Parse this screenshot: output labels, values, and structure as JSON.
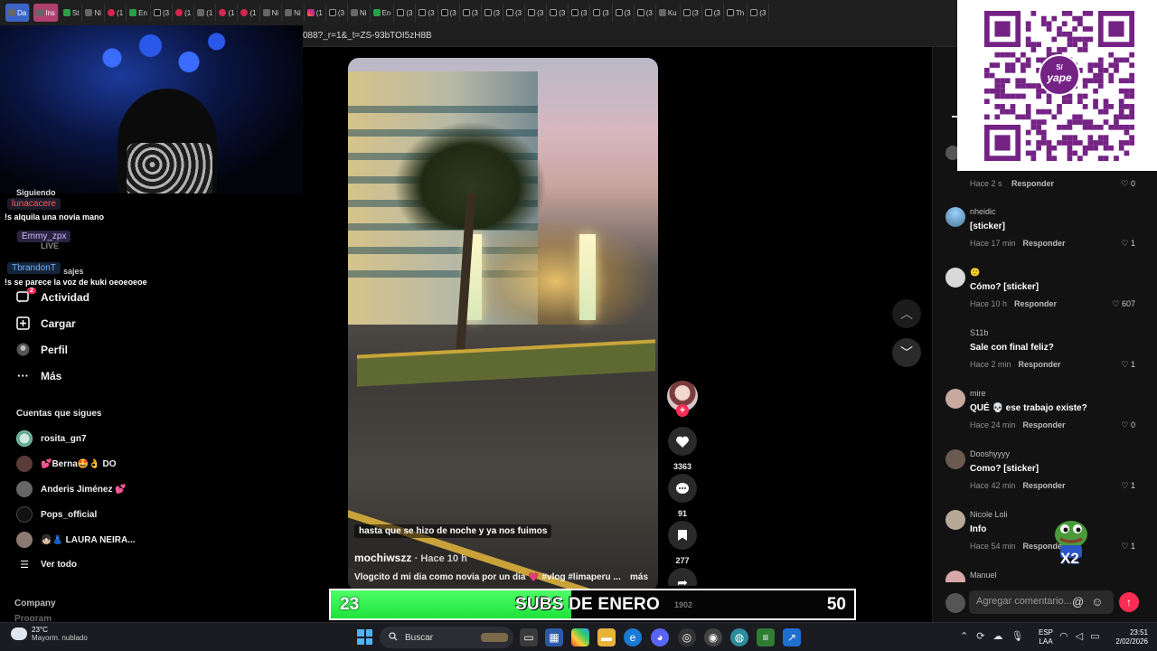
{
  "browser": {
    "tabs": [
      {
        "label": "Da",
        "style": "blue",
        "icon": "doc-icon"
      },
      {
        "label": "Ins",
        "style": "pink",
        "icon": "doc-icon"
      },
      {
        "label": "St",
        "icon": "kick-icon"
      },
      {
        "label": "Ni",
        "icon": "doc-icon"
      },
      {
        "label": "(1",
        "icon": "youtube-icon"
      },
      {
        "label": "En",
        "icon": "kick-icon"
      },
      {
        "label": "(3",
        "icon": "tiktok-icon"
      },
      {
        "label": "(1",
        "icon": "youtube-icon"
      },
      {
        "label": "(1",
        "icon": "audio-icon"
      },
      {
        "label": "(1",
        "icon": "youtube-icon"
      },
      {
        "label": "(1",
        "icon": "youtube-icon"
      },
      {
        "label": "Ni",
        "icon": "doc-icon"
      },
      {
        "label": "Ni",
        "icon": "doc-icon"
      },
      {
        "label": "(1",
        "icon": "instagram-icon"
      },
      {
        "label": "(3",
        "icon": "tiktok-icon"
      },
      {
        "label": "Ni",
        "icon": "doc-icon"
      },
      {
        "label": "En",
        "icon": "kick-icon"
      },
      {
        "label": "(3",
        "icon": "tiktok-icon"
      },
      {
        "label": "(3",
        "icon": "tiktok-icon"
      },
      {
        "label": "(3",
        "icon": "tiktok-icon"
      },
      {
        "label": "(3",
        "icon": "tiktok-icon"
      },
      {
        "label": "(3",
        "icon": "tiktok-icon"
      },
      {
        "label": "(3",
        "icon": "tiktok-icon"
      },
      {
        "label": "(3",
        "icon": "tiktok-icon"
      },
      {
        "label": "(3",
        "icon": "tiktok-icon"
      },
      {
        "label": "(3",
        "icon": "tiktok-icon"
      },
      {
        "label": "(3",
        "icon": "tiktok-icon"
      },
      {
        "label": "(3",
        "icon": "tiktok-icon"
      },
      {
        "label": "(3",
        "icon": "tiktok-icon"
      },
      {
        "label": "Ku",
        "icon": "doc-icon"
      },
      {
        "label": "(3",
        "icon": "tiktok-icon"
      },
      {
        "label": "(3",
        "icon": "tiktok-icon"
      },
      {
        "label": "Th",
        "icon": "tiktok-icon"
      },
      {
        "label": "(3",
        "icon": "tiktok-icon"
      }
    ],
    "url": "088?_r=1&_t=ZS-93bTOI5zH8B"
  },
  "stream_chat": {
    "partial_label": "Siguiendo",
    "messages": [
      {
        "user": "lunacacere",
        "text": "!s alquila una novia mano"
      },
      {
        "user": "Emmy_zpx",
        "text": ""
      },
      {
        "user": "TbrandonT",
        "text": "!s se parece la voz de kuki oeoeoeoe"
      }
    ],
    "partial_live": "LIVE",
    "partial_messages": "sajes"
  },
  "sidebar": {
    "nav": [
      {
        "label": "Actividad",
        "icon": "activity-icon",
        "badge": "2"
      },
      {
        "label": "Cargar",
        "icon": "upload-icon"
      },
      {
        "label": "Perfil",
        "icon": "profile-icon"
      },
      {
        "label": "Más",
        "icon": "more-icon"
      }
    ],
    "following_title": "Cuentas que sigues",
    "following": [
      {
        "name": "rosita_gn7"
      },
      {
        "name": "💕Berna🤩👌 DO"
      },
      {
        "name": "Anderis Jiménez 💕"
      },
      {
        "name": "Pops_official"
      },
      {
        "name": "👧🏻👗 LAURA NEIRA..."
      }
    ],
    "see_all": "Ver todo",
    "footer": [
      "Company",
      "Program"
    ]
  },
  "video": {
    "overlay_caption": "hasta que se hizo de noche y ya nos fuimos",
    "author": "mochiwszz",
    "posted": "· Hace 10 h",
    "description": "Vlogcito d mi dia como novia por un dia 💗 #vlog #limaperu ...",
    "more": "más",
    "likes": "3363",
    "comments": "91",
    "saves": "277"
  },
  "comments": [
    {
      "user": "",
      "text": "",
      "time": "Hace 2 s",
      "reply": "Responder",
      "likes": "0"
    },
    {
      "user": "nheidic",
      "text": "[sticker]",
      "time": "Hace 17 min",
      "reply": "Responder",
      "likes": "1"
    },
    {
      "user": "🙂",
      "text": "Cómo? [sticker]",
      "time": "Hace 10 h",
      "reply": "Responder",
      "likes": "607"
    },
    {
      "user": "S11b",
      "text": "Sale con final feliz?",
      "time": "Hace 2 min",
      "reply": "Responder",
      "likes": "1"
    },
    {
      "user": "mire",
      "text": "QUÉ 💀 ese trabajo existe?",
      "time": "Hace 24 min",
      "reply": "Responder",
      "likes": "0"
    },
    {
      "user": "Dooshyyyy",
      "text": "Como? [sticker]",
      "time": "Hace 42 min",
      "reply": "Responder",
      "likes": "1"
    },
    {
      "user": "Nicole Loli",
      "text": "Info",
      "time": "Hace 54 min",
      "reply": "Responder",
      "likes": "1"
    },
    {
      "user": "Manuel",
      "text": "",
      "time": "",
      "reply": "",
      "likes": ""
    }
  ],
  "comment_input": {
    "placeholder": "Agregar comentario..."
  },
  "qr": {
    "brand": "yape",
    "symbol": "S/"
  },
  "sticker": {
    "label": "X2"
  },
  "subs_goal": {
    "current": "23",
    "title_a": "SUBS",
    "title_b": "DE ENERO",
    "faint": "1902",
    "goal": "50",
    "fill_fraction": 0.46
  },
  "taskbar": {
    "temp": "23°C",
    "weather": "Mayorm. nublado",
    "search": "Buscar",
    "lang": [
      "ESP",
      "LAA"
    ],
    "time": "23:51",
    "date": "2/02/2026"
  },
  "colors": {
    "accent": "#fe2c55",
    "goal_green": "#2cf04a",
    "yape_purple": "#742284"
  }
}
